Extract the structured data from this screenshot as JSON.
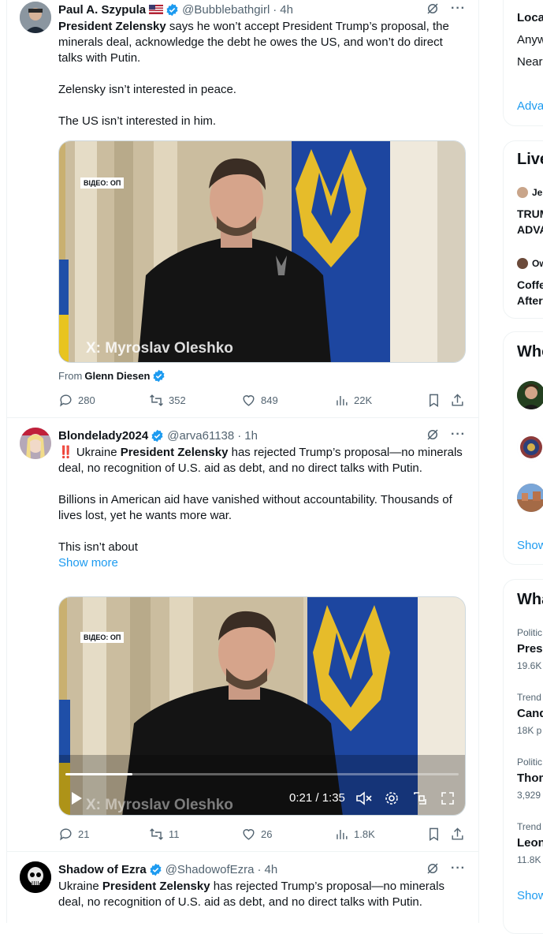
{
  "tweets": [
    {
      "name": "Paul A. Szypula",
      "handle": "@Bubblebathgirl",
      "time": "4h",
      "paragraphs": [
        {
          "parts": [
            {
              "b": "President Zelensky"
            },
            {
              "t": " says he won’t accept President Trump’s proposal, the minerals deal, acknowledge the debt he owes the US, and won’t do direct talks with Putin."
            }
          ]
        },
        {
          "parts": [
            {
              "t": "Zelensky isn’t interested in peace."
            }
          ]
        },
        {
          "parts": [
            {
              "t": "The US isn’t interested in him."
            }
          ]
        }
      ],
      "video_badge": "ВІДЕО: ОП",
      "video_watermark": "X: Myroslav Oleshko",
      "from_label": "From",
      "from_name": "Glenn Diesen",
      "replies": "280",
      "reposts": "352",
      "likes": "849",
      "views": "22K"
    },
    {
      "name": "Blondelady2024",
      "handle": "@arva61138",
      "time": "1h",
      "paragraphs": [
        {
          "parts": [
            {
              "t": "‼️ Ukraine "
            },
            {
              "b": "President Zelensky"
            },
            {
              "t": " has rejected Trump’s proposal—no minerals deal, no recognition of U.S. aid as debt, and no direct talks with Putin."
            }
          ]
        },
        {
          "parts": [
            {
              "t": "Billions in American aid have vanished without accountability. Thousands of lives lost, yet he wants more war."
            }
          ]
        },
        {
          "parts": [
            {
              "t": "This isn’t about"
            }
          ]
        }
      ],
      "show_more": "Show more",
      "video_badge": "ВІДЕО: ОП",
      "video_watermark": "X: Myroslav Oleshko",
      "video_time": "0:21 / 1:35",
      "video_progress": 0.17,
      "replies": "21",
      "reposts": "11",
      "likes": "26",
      "views": "1.8K"
    },
    {
      "name": "Shadow of Ezra",
      "handle": "@ShadowofEzra",
      "time": "4h",
      "paragraphs": [
        {
          "parts": [
            {
              "t": "Ukraine "
            },
            {
              "b": "President Zelensky"
            },
            {
              "t": " has rejected Trump’s proposal—no minerals deal, no recognition of U.S. aid as debt, and no direct talks with Putin."
            }
          ]
        }
      ]
    }
  ],
  "sidebar": {
    "location": {
      "title": "Loca",
      "line1": "Anyw",
      "line2": "Near",
      "link": "Adva"
    },
    "live": {
      "title": "Live",
      "item1_user": "Je",
      "item1_line1": "TRUM",
      "item1_line2": "ADVA",
      "item2_user": "Ow",
      "item2_line1": "Coffe",
      "item2_line2": "After"
    },
    "follow": {
      "title": "Who",
      "show": "Show"
    },
    "trends": {
      "title": "Wha",
      "items": [
        {
          "context": "Politic",
          "name": "Presi",
          "count": "19.6K"
        },
        {
          "context": "Trend",
          "name": "Cand",
          "count": "18K p"
        },
        {
          "context": "Politic",
          "name": "Thom",
          "count": "3,929"
        },
        {
          "context": "Trend",
          "name": "Leon",
          "count": "11.8K"
        }
      ],
      "show": "Show"
    }
  },
  "colors": {
    "accent": "#1d9bf0",
    "text": "#0f1419",
    "muted": "#536471",
    "border": "#eff3f4"
  }
}
